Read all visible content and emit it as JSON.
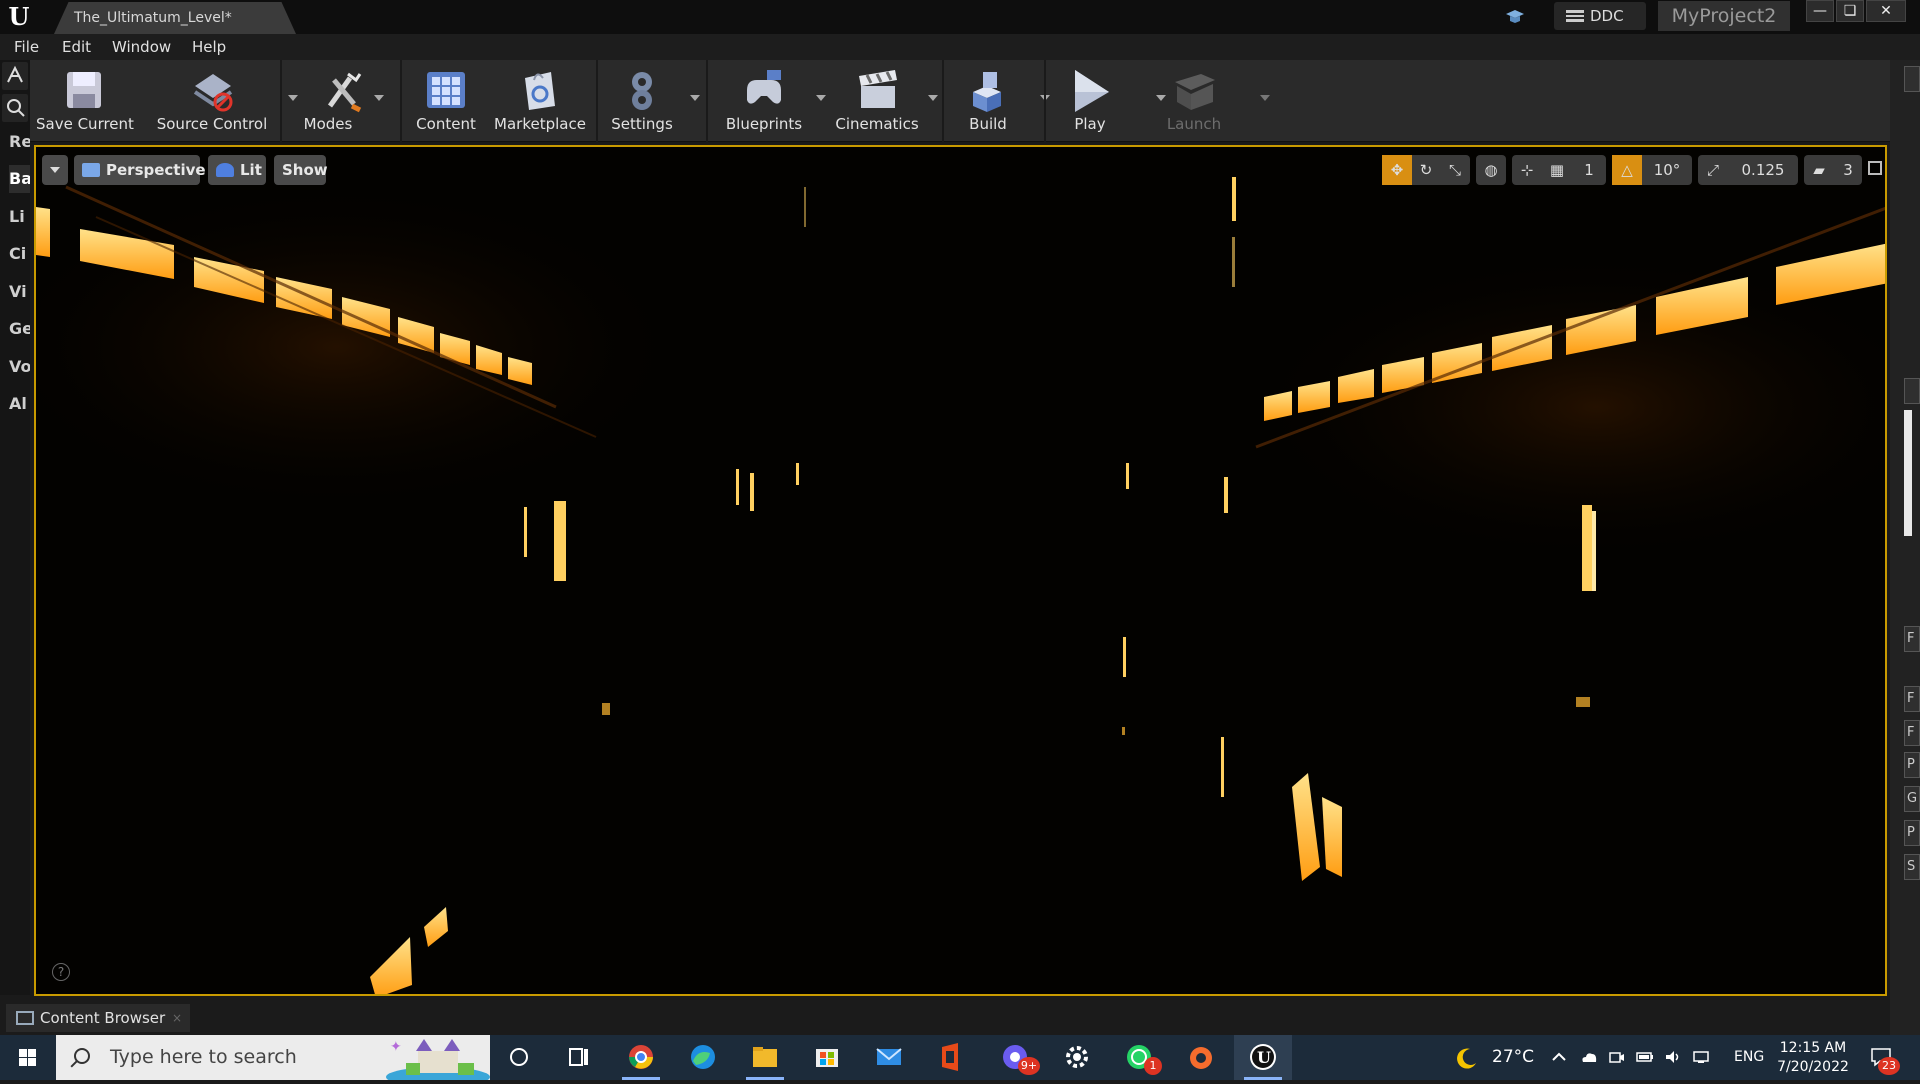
{
  "window": {
    "level_tab": "The_Ultimatum_Level*",
    "ddc_label": "DDC",
    "project_name": "MyProject2",
    "controls": [
      "—",
      "❏",
      "✕"
    ]
  },
  "menu": [
    "File",
    "Edit",
    "Window",
    "Help"
  ],
  "left_tabs": [
    {
      "label": "Re",
      "active": false
    },
    {
      "label": "Ba",
      "active": true
    },
    {
      "label": "Li",
      "active": false
    },
    {
      "label": "Ci",
      "active": false
    },
    {
      "label": "Vi",
      "active": false
    },
    {
      "label": "Ge",
      "active": false
    },
    {
      "label": "Vo",
      "active": false
    },
    {
      "label": "Al",
      "active": false
    }
  ],
  "toolbar": {
    "save_current": "Save Current",
    "source_control": "Source Control",
    "modes": "Modes",
    "content": "Content",
    "marketplace": "Marketplace",
    "settings": "Settings",
    "blueprints": "Blueprints",
    "cinematics": "Cinematics",
    "build": "Build",
    "play": "Play",
    "launch": "Launch"
  },
  "viewport": {
    "perspective_label": "Perspective",
    "lit_label": "Lit",
    "show_label": "Show",
    "grid_snap_value": "1",
    "rotation_snap": "10°",
    "scale_snap": "0.125",
    "camera_speed": "3",
    "help_glyph": "?"
  },
  "right_tabs": [
    "F",
    "F",
    "F",
    "P",
    "G",
    "P",
    "S"
  ],
  "bottom": {
    "content_browser_tab": "Content Browser",
    "close_glyph": "×"
  },
  "taskbar": {
    "search_placeholder": "Type here to search",
    "apps": [
      "cortana",
      "task-view",
      "chrome",
      "edge",
      "file-explorer",
      "microsoft-store",
      "mail",
      "office",
      "chat-app",
      "settings",
      "whatsapp",
      "origin",
      "unreal-engine"
    ],
    "chat_badge": "9+",
    "whatsapp_badge": "1",
    "temperature": "27°C",
    "language": "ENG",
    "time": "12:15 AM",
    "date": "7/20/2022",
    "notification_count": "23"
  },
  "colors": {
    "accent_orange": "#d98f12",
    "viewport_border": "#c89a00",
    "warm_light": "#ffc83a"
  }
}
